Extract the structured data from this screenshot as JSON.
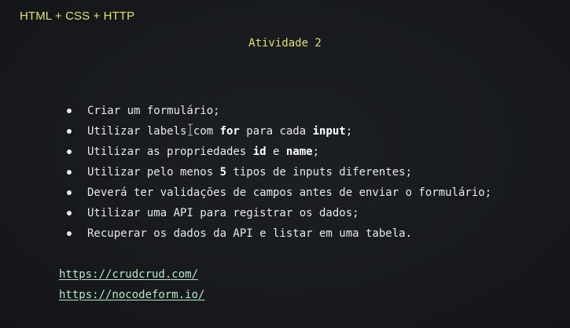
{
  "slide": {
    "course_title": "HTML + CSS + HTTP",
    "activity_title": "Atividade 2",
    "tasks": [
      {
        "segments": [
          {
            "text": "Criar um formulário;"
          }
        ]
      },
      {
        "segments": [
          {
            "text": "Utilizar labels com "
          },
          {
            "text": "for",
            "bold": true
          },
          {
            "text": " para cada "
          },
          {
            "text": "input",
            "bold": true
          },
          {
            "text": ";"
          }
        ]
      },
      {
        "segments": [
          {
            "text": "Utilizar as propriedades "
          },
          {
            "text": "id",
            "bold": true
          },
          {
            "text": " e "
          },
          {
            "text": "name",
            "bold": true
          },
          {
            "text": ";"
          }
        ]
      },
      {
        "segments": [
          {
            "text": "Utilizar pelo menos "
          },
          {
            "text": "5",
            "bold": true
          },
          {
            "text": " tipos de inputs diferentes;"
          }
        ]
      },
      {
        "segments": [
          {
            "text": "Deverá ter validações de campos antes de enviar o formulário;"
          }
        ]
      },
      {
        "segments": [
          {
            "text": "Utilizar uma API para registrar os dados;"
          }
        ]
      },
      {
        "segments": [
          {
            "text": "Recuperar os dados da API e listar em uma tabela."
          }
        ]
      }
    ],
    "links": [
      "https://crudcrud.com/",
      "https://nocodeform.io/"
    ]
  },
  "colors": {
    "background": "#17191d",
    "title": "#e3e06a",
    "text": "#e8e8e8",
    "link": "#b6e6c8"
  },
  "icons": {
    "cursor": "text-cursor-icon"
  }
}
